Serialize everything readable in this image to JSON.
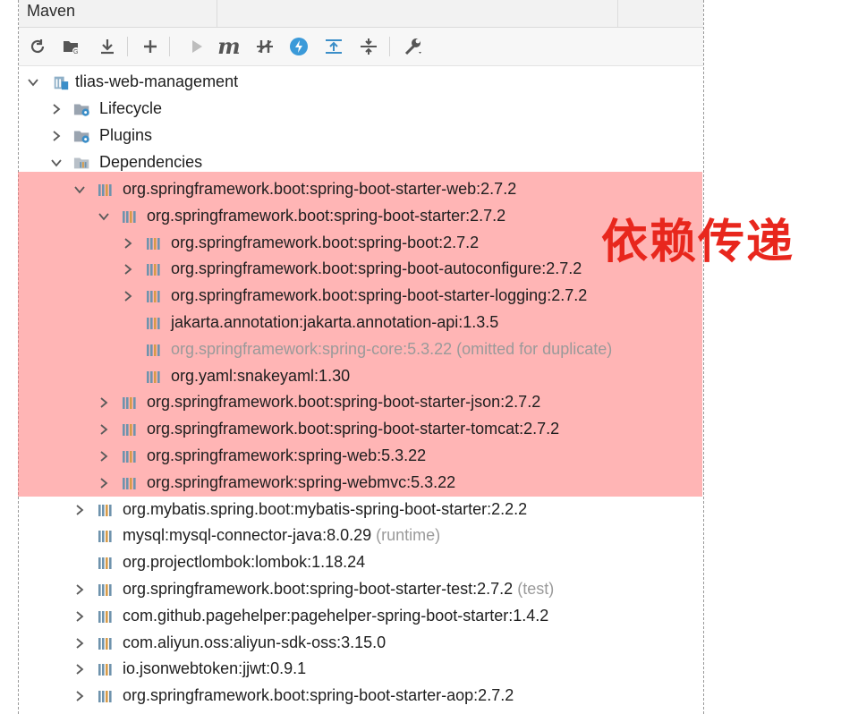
{
  "window": {
    "title": "Maven"
  },
  "toolbar": {
    "buttons": [
      "refresh-icon",
      "folder-icon",
      "download-icon",
      "add-icon",
      "run-icon",
      "maven-icon",
      "skip-tests-icon",
      "offline-icon",
      "expand-all-icon",
      "collapse-all-icon",
      "settings-icon"
    ],
    "maven_label": "m"
  },
  "tree": {
    "root": "tlias-web-management",
    "lifecycle": "Lifecycle",
    "plugins": "Plugins",
    "dependencies": "Dependencies",
    "deps": [
      {
        "label": "org.springframework.boot:spring-boot-starter-web:2.7.2",
        "suffix": ""
      },
      {
        "label": "org.springframework.boot:spring-boot-starter:2.7.2",
        "suffix": ""
      },
      {
        "label": "org.springframework.boot:spring-boot:2.7.2",
        "suffix": ""
      },
      {
        "label": "org.springframework.boot:spring-boot-autoconfigure:2.7.2",
        "suffix": ""
      },
      {
        "label": "org.springframework.boot:spring-boot-starter-logging:2.7.2",
        "suffix": ""
      },
      {
        "label": "jakarta.annotation:jakarta.annotation-api:1.3.5",
        "suffix": ""
      },
      {
        "label": "org.springframework:spring-core:5.3.22",
        "suffix": " (omitted for duplicate)"
      },
      {
        "label": "org.yaml:snakeyaml:1.30",
        "suffix": ""
      },
      {
        "label": "org.springframework.boot:spring-boot-starter-json:2.7.2",
        "suffix": ""
      },
      {
        "label": "org.springframework.boot:spring-boot-starter-tomcat:2.7.2",
        "suffix": ""
      },
      {
        "label": "org.springframework:spring-web:5.3.22",
        "suffix": ""
      },
      {
        "label": "org.springframework:spring-webmvc:5.3.22",
        "suffix": ""
      },
      {
        "label": "org.mybatis.spring.boot:mybatis-spring-boot-starter:2.2.2",
        "suffix": ""
      },
      {
        "label": "mysql:mysql-connector-java:8.0.29",
        "suffix": " (runtime)"
      },
      {
        "label": "org.projectlombok:lombok:1.18.24",
        "suffix": ""
      },
      {
        "label": "org.springframework.boot:spring-boot-starter-test:2.7.2",
        "suffix": " (test)"
      },
      {
        "label": "com.github.pagehelper:pagehelper-spring-boot-starter:1.4.2",
        "suffix": ""
      },
      {
        "label": "com.aliyun.oss:aliyun-sdk-oss:3.15.0",
        "suffix": ""
      },
      {
        "label": "io.jsonwebtoken:jjwt:0.9.1",
        "suffix": ""
      },
      {
        "label": "org.springframework.boot:spring-boot-starter-aop:2.7.2",
        "suffix": ""
      }
    ]
  },
  "annotation": {
    "text": "依赖传递"
  },
  "colors": {
    "highlight": "#ff7878",
    "stamp": "#e8271d",
    "dep_icon": "#6b8fa8"
  }
}
